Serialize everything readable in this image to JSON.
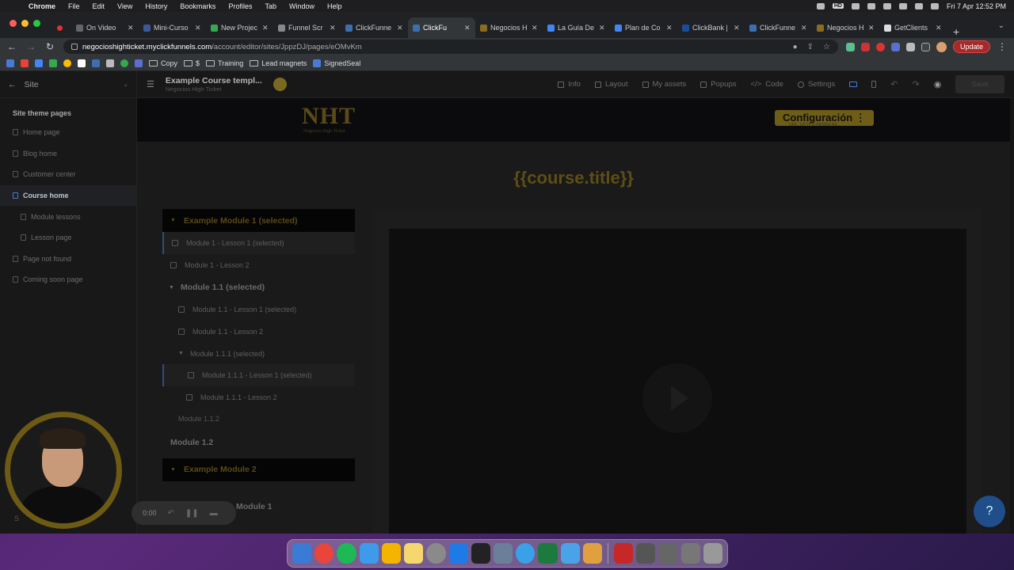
{
  "menubar": {
    "app": "Chrome",
    "items": [
      "File",
      "Edit",
      "View",
      "History",
      "Bookmarks",
      "Profiles",
      "Tab",
      "Window",
      "Help"
    ],
    "datetime": "Fri 7 Apr  12:52 PM",
    "badge": "HD"
  },
  "browser": {
    "tabs": [
      {
        "label": "",
        "color": "#d33"
      },
      {
        "label": "On Video",
        "color": "#666"
      },
      {
        "label": "Mini-Curso",
        "color": "#3b5998"
      },
      {
        "label": "New Projec",
        "color": "#34a853"
      },
      {
        "label": "Funnel Scr",
        "color": "#888"
      },
      {
        "label": "ClickFunne",
        "color": "#3d6fb0"
      },
      {
        "label": "ClickFu",
        "color": "#3d6fb0",
        "active": true
      },
      {
        "label": "Negocios H",
        "color": "#8a6d1e"
      },
      {
        "label": "La Guía De",
        "color": "#4285f4"
      },
      {
        "label": "Plan de Co",
        "color": "#4285f4"
      },
      {
        "label": "ClickBank |",
        "color": "#1a4d9a"
      },
      {
        "label": "ClickFunne",
        "color": "#3d6fb0"
      },
      {
        "label": "Negocios H",
        "color": "#8a6d1e"
      },
      {
        "label": "GetClients",
        "color": "#ddd"
      }
    ],
    "url_host": "negocioshighticket.myclickfunnels.com",
    "url_path": "/account/editor/sites/JppzDJ/pages/eOMvKm",
    "update_label": "Update",
    "bookmarks": [
      {
        "label": "Copy",
        "type": "folder"
      },
      {
        "label": "$",
        "type": "folder"
      },
      {
        "label": "Training",
        "type": "folder"
      },
      {
        "label": "Lead magnets",
        "type": "folder"
      },
      {
        "label": "SignedSeal",
        "type": "link"
      }
    ]
  },
  "editor": {
    "sidebar": {
      "title": "Site",
      "section": "Site theme pages",
      "items": [
        {
          "label": "Home page",
          "sub": false,
          "active": false
        },
        {
          "label": "Blog home",
          "sub": false,
          "active": false
        },
        {
          "label": "Customer center",
          "sub": false,
          "active": false
        },
        {
          "label": "Course home",
          "sub": false,
          "active": true
        },
        {
          "label": "Module lessons",
          "sub": true,
          "active": false
        },
        {
          "label": "Lesson page",
          "sub": true,
          "active": false
        },
        {
          "label": "Page not found",
          "sub": false,
          "active": false
        },
        {
          "label": "Coming soon page",
          "sub": false,
          "active": false
        }
      ],
      "footer_label": "S"
    },
    "topbar": {
      "title": "Example Course templ...",
      "subtitle": "Negocios High Ticket",
      "actions": [
        "Info",
        "Layout",
        "My assets",
        "Popups",
        "Code",
        "Settings"
      ],
      "save_label": "Save"
    }
  },
  "page": {
    "logo_text": "NHT",
    "logo_sub": "Negocios High Ticket",
    "config_label": "Configuración ⋮",
    "config_url": "URL: HTTPS://WWW.NE...",
    "course_title": "{{course.title}}",
    "module1": {
      "title": "Example Module 1 (selected)",
      "lessons": [
        {
          "label": "Module 1 - Lesson 1 (selected)",
          "selected": true
        },
        {
          "label": "Module 1 - Lesson 2",
          "selected": false
        }
      ],
      "sub_module": {
        "title": "Module 1.1 (selected)",
        "lessons": [
          {
            "label": "Module 1.1 - Lesson 1 (selected)",
            "selected": false
          },
          {
            "label": "Module 1.1 - Lesson 2",
            "selected": false
          }
        ],
        "sub_sub_module": {
          "title": "Module 1.1.1 (selected)",
          "lessons": [
            {
              "label": "Module 1.1.1 - Lesson 1 (selected)",
              "selected": true
            },
            {
              "label": "Module 1.1.1 - Lesson 2",
              "selected": false
            }
          ]
        },
        "extra": "Module 1.1.2"
      },
      "sibling": "Module 1.2"
    },
    "module2": {
      "title": "Example Module 2",
      "first_item": "Module 1"
    }
  },
  "recorder": {
    "time": "0:00"
  }
}
